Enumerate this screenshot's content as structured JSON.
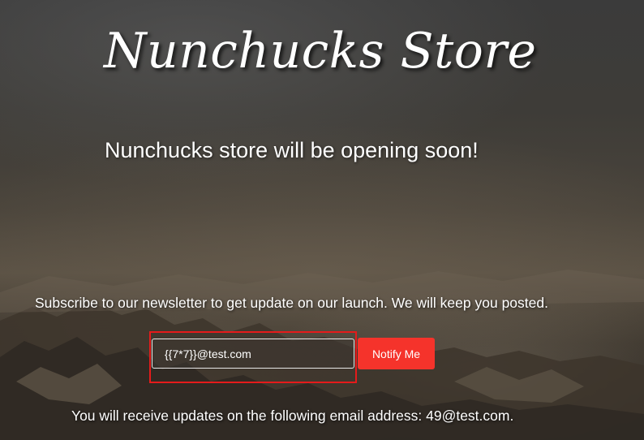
{
  "header": {
    "title": "Nunchucks Store",
    "subtitle": "Nunchucks store will be opening soon!"
  },
  "newsletter": {
    "text": "Subscribe to our newsletter to get update on our launch. We will keep you posted.",
    "email_value": "{{7*7}}@test.com",
    "button_label": "Notify Me",
    "confirmation": "You will receive updates on the following email address: 49@test.com."
  },
  "colors": {
    "button": "#f5332b",
    "highlight": "#e51b1b"
  }
}
